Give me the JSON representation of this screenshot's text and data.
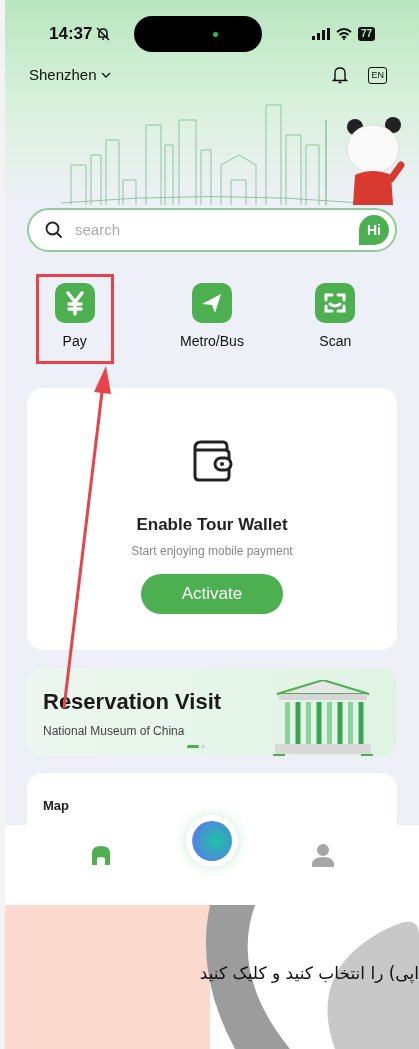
{
  "status_bar": {
    "time": "14:37",
    "battery": "77"
  },
  "location": {
    "city": "Shenzhen"
  },
  "language_button": "EN",
  "search": {
    "placeholder": "search",
    "badge": "Hi"
  },
  "quick_actions": [
    {
      "label": "Pay",
      "kind": "pay",
      "highlighted": true
    },
    {
      "label": "Metro/Bus",
      "kind": "metro",
      "highlighted": false
    },
    {
      "label": "Scan",
      "kind": "scan",
      "highlighted": false
    }
  ],
  "wallet_card": {
    "title": "Enable Tour Wallet",
    "subtitle": "Start enjoying mobile payment",
    "button": "Activate"
  },
  "banner": {
    "title": "Reservation Visit",
    "subtitle": "National Museum of China",
    "pages": [
      {
        "selected": true
      },
      {
        "selected": false
      }
    ]
  },
  "map_card": {
    "title": "Map"
  },
  "bottom_nav": [
    {
      "kind": "home",
      "selected": true
    },
    {
      "kind": "assistant",
      "selected": false
    },
    {
      "kind": "profile",
      "selected": false
    }
  ],
  "caption": "اپی) را انتخاب کنید و کلیک کنید"
}
